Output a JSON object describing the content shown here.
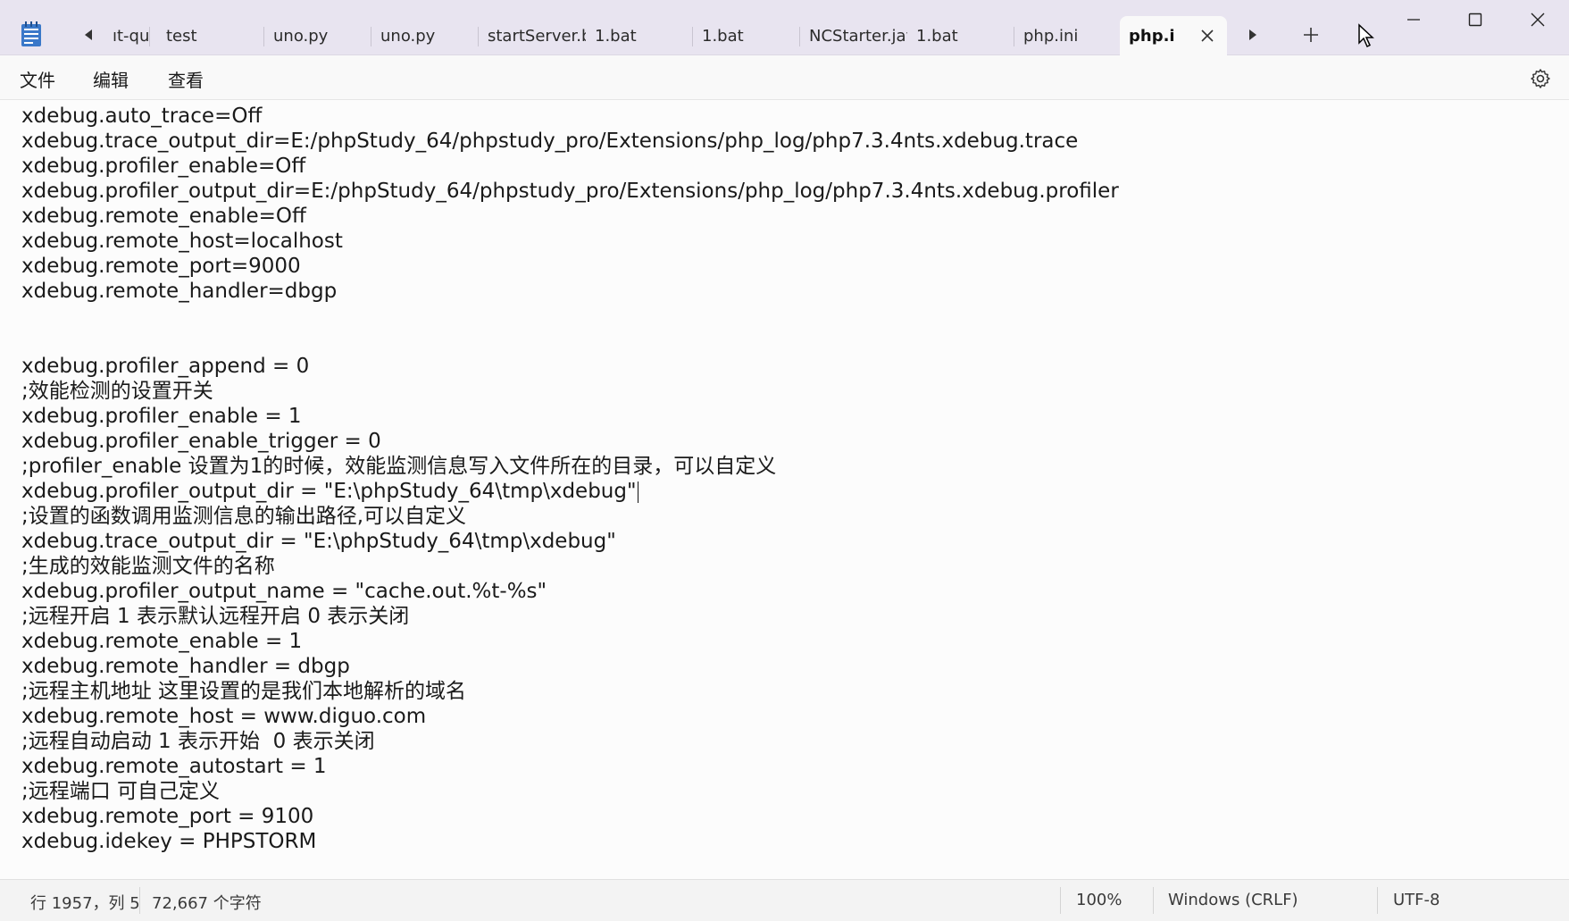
{
  "tabs": [
    {
      "label": "ıt-qu",
      "active": false
    },
    {
      "label": "test",
      "active": false
    },
    {
      "label": "uno.py",
      "active": false
    },
    {
      "label": "uno.py",
      "active": false
    },
    {
      "label": "startServer.b",
      "active": false
    },
    {
      "label": "1.bat",
      "active": false
    },
    {
      "label": "1.bat",
      "active": false
    },
    {
      "label": "NCStarter.jav",
      "active": false
    },
    {
      "label": "1.bat",
      "active": false
    },
    {
      "label": "php.ini",
      "active": false
    },
    {
      "label": "php.ir",
      "active": true
    }
  ],
  "menu": {
    "file": "文件",
    "edit": "编辑",
    "view": "查看"
  },
  "editor": {
    "lines": [
      "xdebug.auto_trace=Off",
      "xdebug.trace_output_dir=E:/phpStudy_64/phpstudy_pro/Extensions/php_log/php7.3.4nts.xdebug.trace",
      "xdebug.profiler_enable=Off",
      "xdebug.profiler_output_dir=E:/phpStudy_64/phpstudy_pro/Extensions/php_log/php7.3.4nts.xdebug.profiler",
      "xdebug.remote_enable=Off",
      "xdebug.remote_host=localhost",
      "xdebug.remote_port=9000",
      "xdebug.remote_handler=dbgp",
      "",
      "",
      "xdebug.profiler_append = 0",
      ";效能检测的设置开关",
      "xdebug.profiler_enable = 1",
      "xdebug.profiler_enable_trigger = 0",
      ";profiler_enable 设置为1的时候，效能监测信息写入文件所在的目录，可以自定义",
      "xdebug.profiler_output_dir = \"E:\\phpStudy_64\\tmp\\xdebug\"",
      ";设置的函数调用监测信息的输出路径,可以自定义",
      "xdebug.trace_output_dir = \"E:\\phpStudy_64\\tmp\\xdebug\"",
      ";生成的效能监测文件的名称",
      "xdebug.profiler_output_name = \"cache.out.%t-%s\"",
      ";远程开启 1 表示默认远程开启 0 表示关闭",
      "xdebug.remote_enable = 1",
      "xdebug.remote_handler = dbgp",
      ";远程主机地址 这里设置的是我们本地解析的域名",
      "xdebug.remote_host = www.diguo.com",
      ";远程自动启动 1 表示开始  0 表示关闭",
      "xdebug.remote_autostart = 1",
      ";远程端口 可自己定义",
      "xdebug.remote_port = 9100",
      "xdebug.idekey = PHPSTORM"
    ],
    "caret_line": 15
  },
  "status": {
    "position": "行 1957，列 5",
    "char_count": "72,667 个字符",
    "zoom": "100%",
    "line_ending": "Windows (CRLF)",
    "encoding": "UTF-8"
  },
  "colors": {
    "titlebar": "#e8e4f0",
    "editor_bg": "#fcfcfc",
    "status_bg": "#f3f3f3",
    "notepad_icon": "#3a78c9"
  }
}
